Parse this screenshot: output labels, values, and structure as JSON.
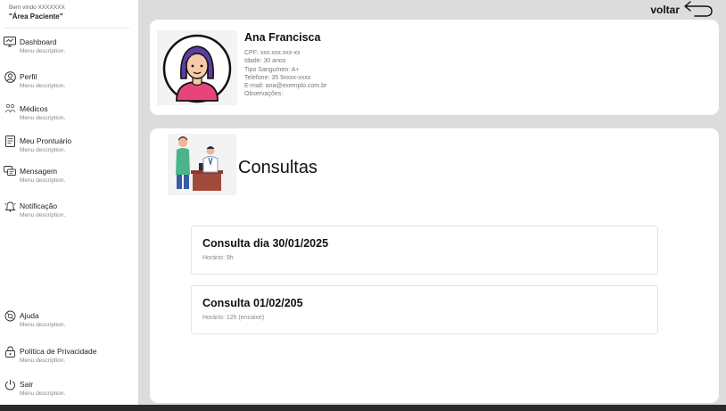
{
  "sidebar": {
    "welcome": "Bem vindo XXXXXXX",
    "area_title": "\"Área Paciente\"",
    "items": [
      {
        "label": "Dashboard",
        "desc": "Menu description.",
        "icon": "dashboard-icon"
      },
      {
        "label": "Perfil",
        "desc": "Menu description.",
        "icon": "user-icon"
      },
      {
        "label": "Médicos",
        "desc": "Menu description.",
        "icon": "doctors-icon"
      },
      {
        "label": "Meu Prontuário",
        "desc": "Menu description.",
        "icon": "document-icon"
      },
      {
        "label": "Mensagem",
        "desc": "Menu description.",
        "icon": "message-icon"
      },
      {
        "label": "Notificação",
        "desc": "Menu description.",
        "icon": "bell-icon"
      }
    ],
    "bottom_items": [
      {
        "label": "Ajuda",
        "desc": "Menu description.",
        "icon": "help-icon"
      },
      {
        "label": "Política de Privacidade",
        "desc": "Menu description.",
        "icon": "lock-icon"
      },
      {
        "label": "Sair",
        "desc": "Menu description.",
        "icon": "power-icon"
      }
    ]
  },
  "header": {
    "back_label": "voltar"
  },
  "profile": {
    "name": "Ana Francisca",
    "cpf": "CPF: xxx.xxx.xxx-xx",
    "idade": "Idade: 30 anos",
    "tipo_sanguineo": "Tipo Sanguíneo: A+",
    "telefone": "Telefone: 35 9xxxx-xxxx",
    "email": "E-mail: ana@exemplo.com.br",
    "observacoes": "Observações:"
  },
  "consultas": {
    "title": "Consultas",
    "items": [
      {
        "title": "Consulta dia 30/01/2025",
        "time": "Horário: 9h"
      },
      {
        "title": "Consulta 01/02/205",
        "time": "Horário: 12h (encaixe)"
      }
    ]
  },
  "colors": {
    "background": "#dcdcdc",
    "card": "#ffffff",
    "avatar_accent": "#e8447a",
    "avatar_hair": "#5b3fa0"
  }
}
